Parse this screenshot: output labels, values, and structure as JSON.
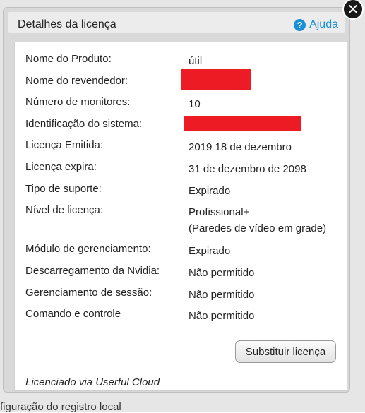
{
  "dialog": {
    "title": "Detalhes da licença",
    "help_label": "Ajuda",
    "close_symbol": "✕"
  },
  "rows": [
    {
      "label": "Nome do Produto:",
      "value": "útil"
    },
    {
      "label": "Nome do revendedor:",
      "value": ""
    },
    {
      "label": "Número de monitores:",
      "value": "10"
    },
    {
      "label": "Identificação do sistema:",
      "value": ""
    },
    {
      "label": "Licença Emitida:",
      "value": "2019 18 de dezembro"
    },
    {
      "label": "Licença expira:",
      "value": "31 de dezembro de 2098"
    },
    {
      "label": "Tipo de suporte:",
      "value": "Expirado"
    },
    {
      "label": "Nível de licença:",
      "value": "Profissional+",
      "value2": "(Paredes de vídeo em grade)"
    },
    {
      "label": "Módulo de gerenciamento:",
      "value": "Expirado"
    },
    {
      "label": "Descarregamento da Nvidia:",
      "value": "Não permitido"
    },
    {
      "label": "Gerenciamento de sessão:",
      "value": "Não permitido"
    },
    {
      "label": "Comando e controle",
      "value": "Não permitido"
    }
  ],
  "replace_button_label": "Substituir licença",
  "footer_text": "Licenciado via Userful Cloud",
  "background": {
    "bottom_text": "figuração do registro local"
  },
  "colors": {
    "help_accent": "#1a8fd6",
    "redaction": "#ed1c24"
  }
}
